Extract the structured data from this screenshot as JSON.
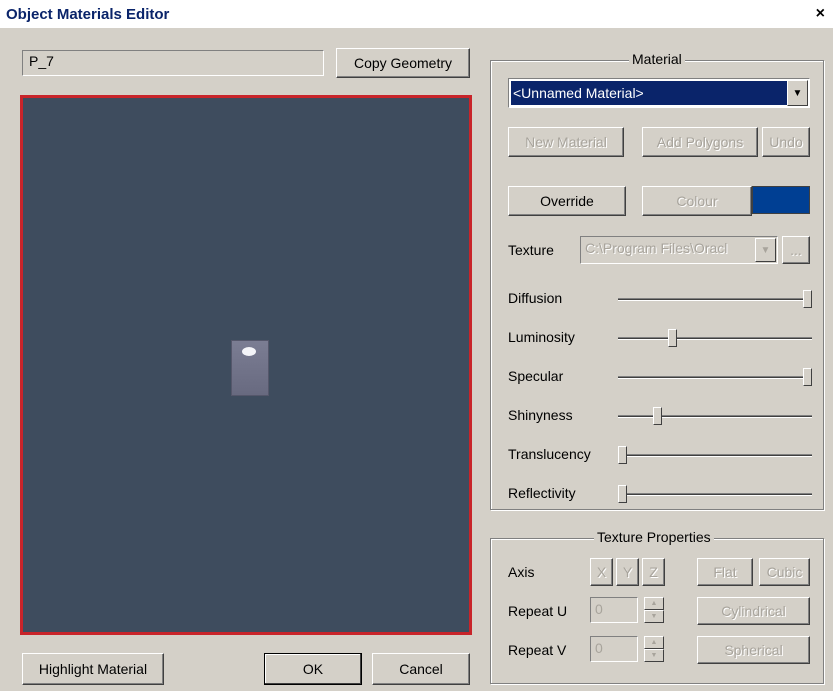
{
  "window": {
    "title": "Object Materials Editor",
    "close_glyph": "×"
  },
  "object_name": "P_7",
  "copy_geometry_label": "Copy Geometry",
  "material_group": {
    "label": "Material",
    "selected_material": "<Unnamed Material>",
    "new_material_label": "New Material",
    "add_polygons_label": "Add Polygons",
    "undo_label": "Undo",
    "override_label": "Override",
    "colour_label": "Colour",
    "colour_value": "#003f93",
    "texture_label": "Texture",
    "texture_path": "C:\\Program Files\\Oracl",
    "browse_label": "...",
    "sliders": [
      {
        "label": "Diffusion",
        "value": 1.0
      },
      {
        "label": "Luminosity",
        "value": 0.27
      },
      {
        "label": "Specular",
        "value": 1.0
      },
      {
        "label": "Shinyness",
        "value": 0.19
      },
      {
        "label": "Translucency",
        "value": 0.0
      },
      {
        "label": "Reflectivity",
        "value": 0.0
      }
    ]
  },
  "texture_properties": {
    "label": "Texture Properties",
    "axis_label": "Axis",
    "axis_x": "X",
    "axis_y": "Y",
    "axis_z": "Z",
    "flat_label": "Flat",
    "cubic_label": "Cubic",
    "repeat_u_label": "Repeat U",
    "repeat_u_value": "0",
    "repeat_v_label": "Repeat V",
    "repeat_v_value": "0",
    "cylindrical_label": "Cylindrical",
    "spherical_label": "Spherical"
  },
  "footer": {
    "highlight_label": "Highlight Material",
    "ok_label": "OK",
    "cancel_label": "Cancel"
  },
  "colors": {
    "viewport_border": "#c8242a",
    "viewport_bg": "#3e4c5e"
  }
}
